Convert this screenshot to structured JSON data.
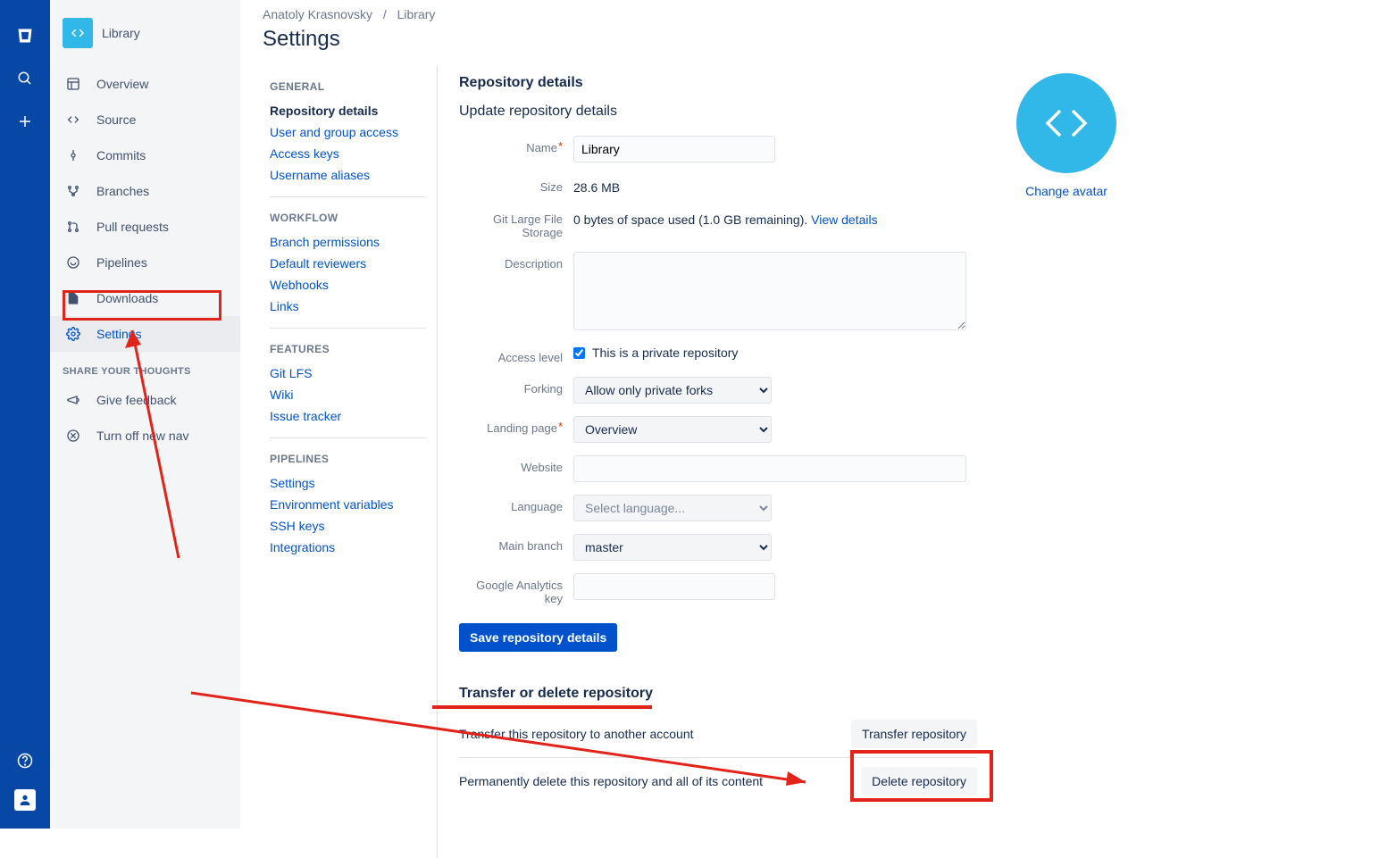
{
  "rail": {
    "logo": "bitbucket",
    "search": "Search",
    "plus": "Create",
    "help": "Help",
    "profile": "Profile"
  },
  "sidebar": {
    "title": "Library",
    "items": [
      {
        "label": "Overview",
        "icon": "overview-icon"
      },
      {
        "label": "Source",
        "icon": "source-icon"
      },
      {
        "label": "Commits",
        "icon": "commits-icon"
      },
      {
        "label": "Branches",
        "icon": "branches-icon"
      },
      {
        "label": "Pull requests",
        "icon": "pullrequests-icon"
      },
      {
        "label": "Pipelines",
        "icon": "pipelines-icon"
      },
      {
        "label": "Downloads",
        "icon": "downloads-icon"
      },
      {
        "label": "Settings",
        "icon": "settings-icon"
      }
    ],
    "section": "SHARE YOUR THOUGHTS",
    "feedback": "Give feedback",
    "turnoff": "Turn off new nav"
  },
  "breadcrumb": {
    "owner": "Anatoly Krasnovsky",
    "repo": "Library"
  },
  "pageTitle": "Settings",
  "settingsNav": {
    "general": {
      "label": "GENERAL",
      "items": [
        "Repository details",
        "User and group access",
        "Access keys",
        "Username aliases"
      ]
    },
    "workflow": {
      "label": "WORKFLOW",
      "items": [
        "Branch permissions",
        "Default reviewers",
        "Webhooks",
        "Links"
      ]
    },
    "features": {
      "label": "FEATURES",
      "items": [
        "Git LFS",
        "Wiki",
        "Issue tracker"
      ]
    },
    "pipelines": {
      "label": "PIPELINES",
      "items": [
        "Settings",
        "Environment variables",
        "SSH keys",
        "Integrations"
      ]
    }
  },
  "main": {
    "detailsHeading": "Repository details",
    "updateHeading": "Update repository details",
    "labels": {
      "name": "Name",
      "size": "Size",
      "lfs": "Git Large File Storage",
      "description": "Description",
      "accessLevel": "Access level",
      "forking": "Forking",
      "landingPage": "Landing page",
      "website": "Website",
      "language": "Language",
      "mainBranch": "Main branch",
      "gaKey": "Google Analytics key"
    },
    "values": {
      "name": "Library",
      "size": "28.6 MB",
      "lfsText": "0 bytes of space used (1.0 GB remaining). ",
      "lfsLink": "View details",
      "privateCheckbox": "This is a private repository",
      "privateChecked": true,
      "forking": "Allow only private forks",
      "landingPage": "Overview",
      "languagePlaceholder": "Select language...",
      "mainBranch": "master"
    },
    "saveButton": "Save repository details",
    "changeAvatar": "Change avatar",
    "transfer": {
      "heading": "Transfer or delete repository",
      "transferText": "Transfer this repository to another account",
      "transferBtn": "Transfer repository",
      "deleteText": "Permanently delete this repository and all of its content",
      "deleteBtn": "Delete repository"
    }
  }
}
